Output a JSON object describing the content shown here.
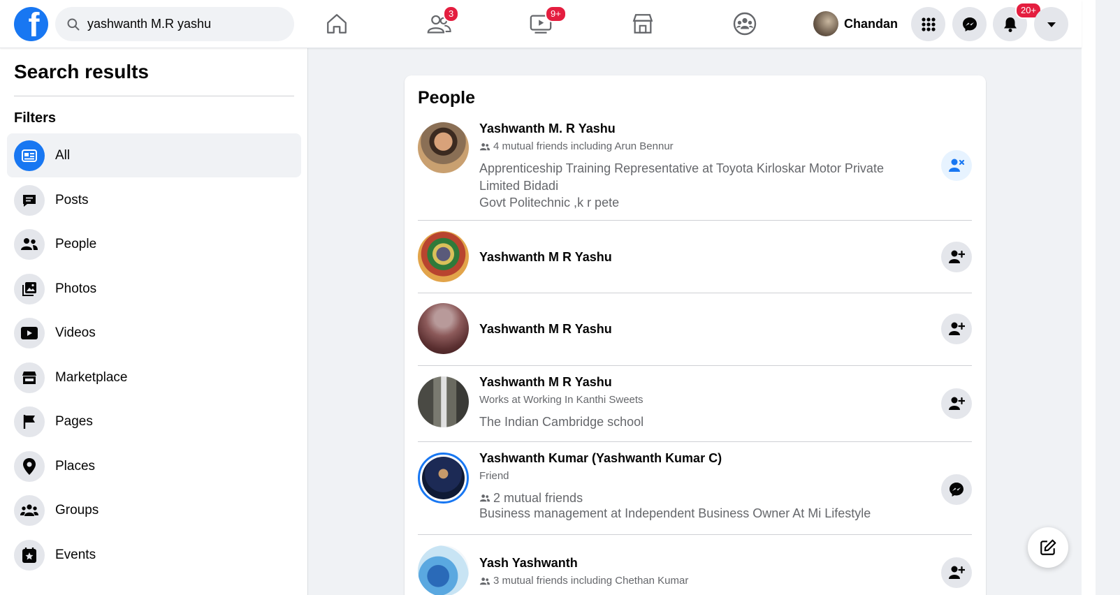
{
  "brand": {
    "logo_letter": "f",
    "color": "#1877f2"
  },
  "search": {
    "value": "yashwanth M.R yashu",
    "icon": "search-icon"
  },
  "nav": {
    "friends_badge": "3",
    "watch_badge": "9+",
    "notifications_badge": "20+",
    "profile_name": "Chandan"
  },
  "sidebar": {
    "title": "Search results",
    "filters_label": "Filters",
    "items": [
      {
        "label": "All",
        "icon": "all-results-icon"
      },
      {
        "label": "Posts",
        "icon": "posts-icon"
      },
      {
        "label": "People",
        "icon": "people-icon"
      },
      {
        "label": "Photos",
        "icon": "photos-icon"
      },
      {
        "label": "Videos",
        "icon": "videos-icon"
      },
      {
        "label": "Marketplace",
        "icon": "marketplace-icon"
      },
      {
        "label": "Pages",
        "icon": "pages-icon"
      },
      {
        "label": "Places",
        "icon": "places-icon"
      },
      {
        "label": "Groups",
        "icon": "groups-icon"
      },
      {
        "label": "Events",
        "icon": "events-icon"
      }
    ]
  },
  "results": {
    "title": "People",
    "people": [
      {
        "name": "Yashwanth M. R Yashu",
        "mutual": "4 mutual friends including Arun Bennur",
        "desc1": "Apprenticeship Training Representative at Toyota Kirloskar Motor Private Limited Bidadi",
        "desc2": "Govt Politechnic ,k r pete",
        "action": "cancel-request"
      },
      {
        "name": "Yashwanth M R Yashu",
        "action": "add-friend"
      },
      {
        "name": "Yashwanth M R Yashu",
        "action": "add-friend"
      },
      {
        "name": "Yashwanth M R Yashu",
        "work": "Works at Working In Kanthi Sweets",
        "desc1": "The Indian Cambridge school",
        "action": "add-friend"
      },
      {
        "name": "Yashwanth Kumar (Yashwanth Kumar C)",
        "relation": "Friend",
        "mutual": "2 mutual friends",
        "desc1": "Business management at Independent Business Owner At Mi Lifestyle",
        "action": "message"
      },
      {
        "name": "Yash Yashwanth",
        "mutual": "3 mutual friends including Chethan Kumar",
        "action": "add-friend"
      }
    ]
  },
  "colors": {
    "accent": "#1877f2",
    "badge": "#e41e3f",
    "secondary_text": "#65676b"
  }
}
